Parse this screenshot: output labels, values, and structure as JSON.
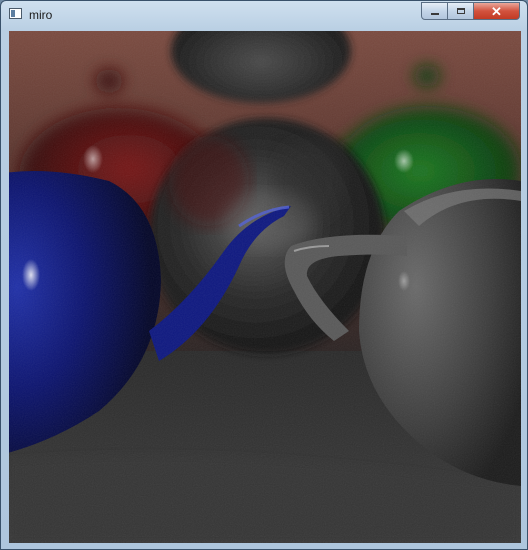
{
  "window": {
    "title": "miro",
    "icon": "app-window-icon",
    "controls": {
      "minimize_icon": "minimize-icon",
      "maximize_icon": "maximize-icon",
      "close_icon": "close-icon",
      "close_glyph": "✕"
    }
  },
  "render": {
    "description_icon": "raytraced-scene-image",
    "colors": {
      "background_wall": "#6b3d33",
      "floor": "#2e2e2e",
      "red_teapot": "#5a0c0c",
      "green_teapot": "#0f4a12",
      "blue_teapot": "#0a0f5c",
      "gray_teapot": "#3a3a3a",
      "mirror_sphere": "#262626"
    }
  }
}
